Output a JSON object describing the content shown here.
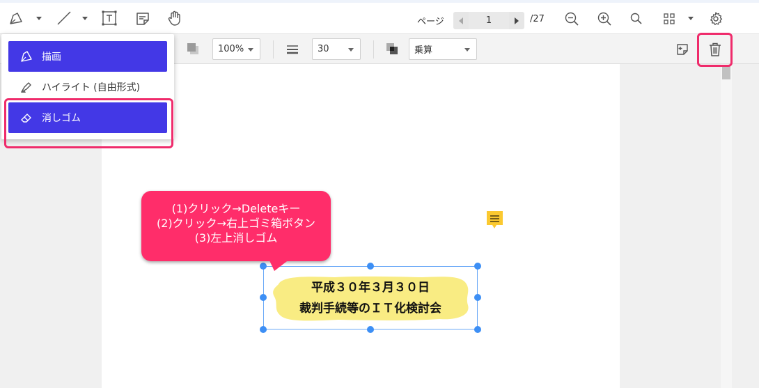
{
  "toolbar": {
    "page_label": "ページ",
    "current_page": "1",
    "page_total": "/27"
  },
  "properties_bar": {
    "opacity_value": "100%",
    "thickness_value": "30",
    "blend_mode_value": "乗算"
  },
  "draw_menu": {
    "items": [
      {
        "label": "描画",
        "icon": "pen-icon",
        "active": true
      },
      {
        "label": "ハイライト (自由形式)",
        "icon": "highlighter-icon",
        "active": false
      },
      {
        "label": "消しゴム",
        "icon": "eraser-icon",
        "active": true
      }
    ]
  },
  "callout": {
    "lines": [
      "(1)クリック→Deleteキー",
      "(2)クリック→右上ゴミ箱ボタン",
      "(3)左上消しゴム"
    ]
  },
  "annotation": {
    "lines": [
      "平成３０年３月３０日",
      "裁判手続等のＩＴ化検討会"
    ],
    "fill_color": "#f9ec83"
  },
  "colors": {
    "accent": "#4338e6",
    "highlight_outline": "#ef2b6b",
    "callout_fill": "#ff2d6a",
    "selection": "#3d8ff5",
    "note": "#fbc930"
  }
}
